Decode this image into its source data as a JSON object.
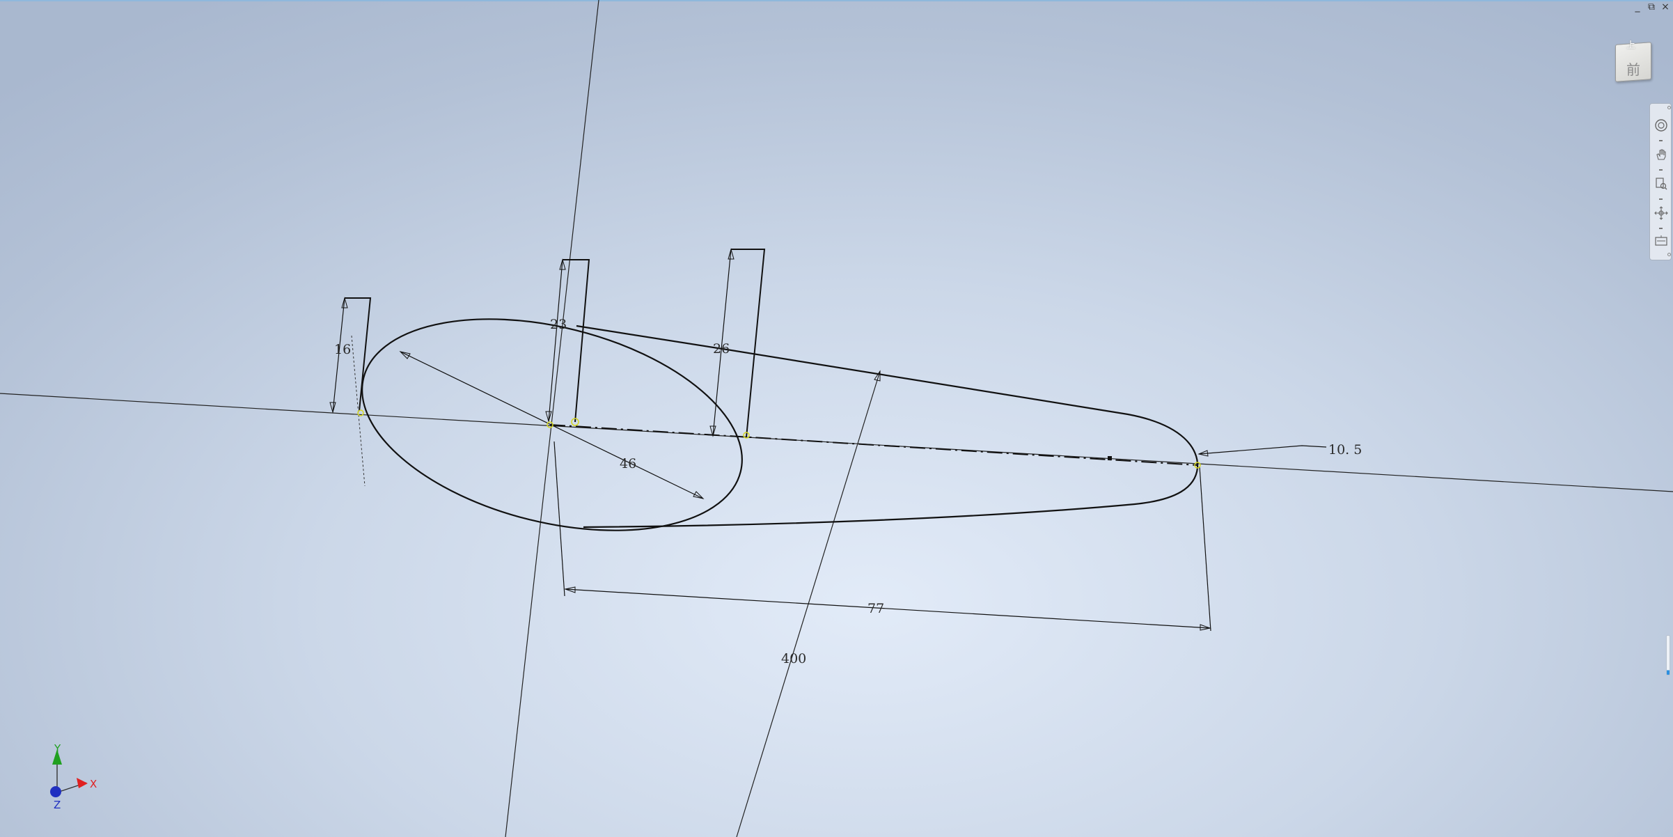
{
  "window_controls": {
    "minimize": "_",
    "restore": "⧉",
    "close": "×"
  },
  "viewcube": {
    "top_label": "上",
    "front_label": "前"
  },
  "navbar": {
    "tools": [
      {
        "name": "full-navigation-wheel-icon"
      },
      {
        "name": "pan-icon"
      },
      {
        "name": "zoom-icon"
      },
      {
        "name": "orbit-icon"
      },
      {
        "name": "look-at-icon"
      }
    ]
  },
  "dimensions": {
    "d16": "16",
    "d23": "23",
    "d26": "26",
    "d46": "46",
    "d10_5": "10. 5",
    "d77": "77",
    "d400": "400"
  },
  "triad": {
    "x_label": "X",
    "y_label": "Y",
    "z_label": "Z",
    "x_color": "#e02020",
    "y_color": "#20a020",
    "z_color": "#2030c0"
  },
  "colors": {
    "sketch_line": "#111111",
    "constraint_point": "#d8d820",
    "accent": "#2c8fe0"
  }
}
